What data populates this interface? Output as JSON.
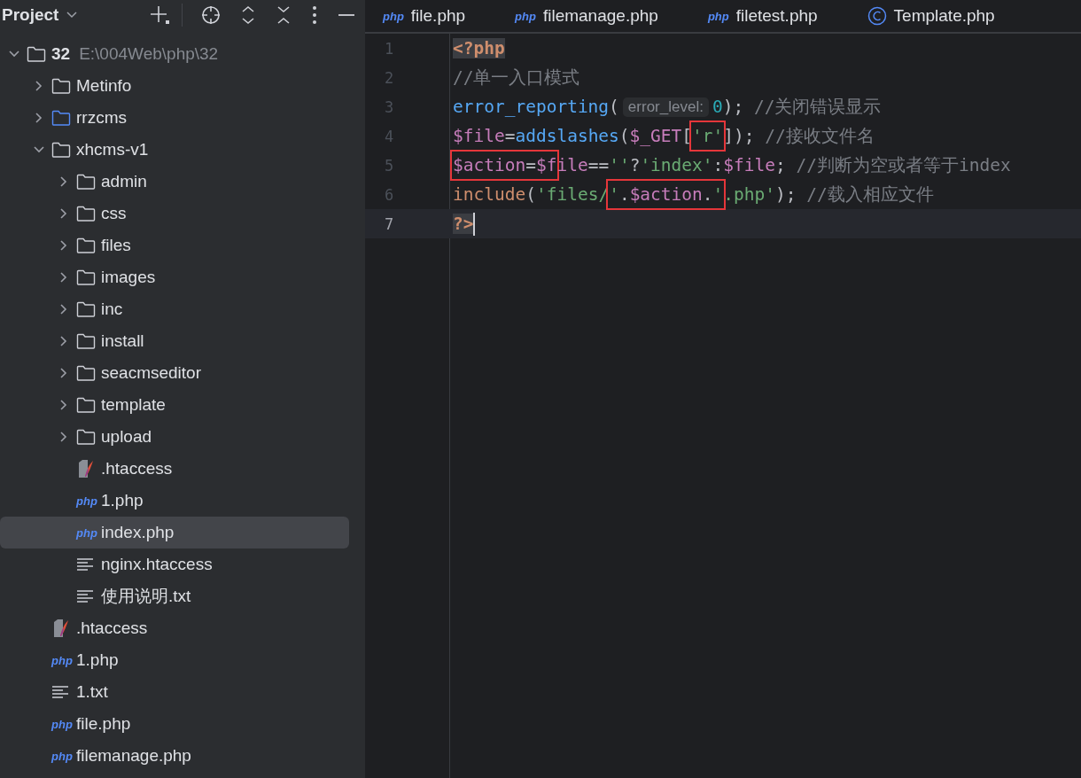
{
  "project_panel": {
    "title": "Project",
    "tree": [
      {
        "name": "32",
        "path": "E:\\004Web\\php\\32",
        "kind": "folder",
        "expanded": true,
        "selected": false,
        "children": [
          {
            "name": "Metinfo",
            "kind": "folder",
            "expanded": false,
            "selected": false
          },
          {
            "name": "rrzcms",
            "kind": "module",
            "expanded": false,
            "selected": false
          },
          {
            "name": "xhcms-v1",
            "kind": "folder",
            "expanded": true,
            "selected": false,
            "children": [
              {
                "name": "admin",
                "kind": "folder",
                "expanded": false,
                "selected": false
              },
              {
                "name": "css",
                "kind": "folder",
                "expanded": false,
                "selected": false
              },
              {
                "name": "files",
                "kind": "folder",
                "expanded": false,
                "selected": false
              },
              {
                "name": "images",
                "kind": "folder",
                "expanded": false,
                "selected": false
              },
              {
                "name": "inc",
                "kind": "folder",
                "expanded": false,
                "selected": false
              },
              {
                "name": "install",
                "kind": "folder",
                "expanded": false,
                "selected": false
              },
              {
                "name": "seacmseditor",
                "kind": "folder",
                "expanded": false,
                "selected": false
              },
              {
                "name": "template",
                "kind": "folder",
                "expanded": false,
                "selected": false
              },
              {
                "name": "upload",
                "kind": "folder",
                "expanded": false,
                "selected": false
              },
              {
                "name": ".htaccess",
                "kind": "htaccess",
                "selected": false
              },
              {
                "name": "1.php",
                "kind": "php",
                "badge": "php",
                "selected": false
              },
              {
                "name": "index.php",
                "kind": "php",
                "badge": "php",
                "selected": true
              },
              {
                "name": "nginx.htaccess",
                "kind": "text",
                "selected": false
              },
              {
                "name": "使用说明.txt",
                "kind": "text",
                "selected": false
              }
            ]
          },
          {
            "name": ".htaccess",
            "kind": "htaccess",
            "selected": false
          },
          {
            "name": "1.php",
            "kind": "php",
            "badge": "php",
            "selected": false
          },
          {
            "name": "1.txt",
            "kind": "text",
            "selected": false
          },
          {
            "name": "file.php",
            "kind": "php",
            "badge": "php",
            "selected": false
          },
          {
            "name": "filemanage.php",
            "kind": "php",
            "badge": "php",
            "selected": false
          }
        ]
      }
    ]
  },
  "tabs": [
    {
      "label": "file.php",
      "kind": "php",
      "badge": "php"
    },
    {
      "label": "filemanage.php",
      "kind": "php",
      "badge": "php"
    },
    {
      "label": "filetest.php",
      "kind": "php",
      "badge": "php"
    },
    {
      "label": "Template.php",
      "kind": "class"
    }
  ],
  "editor": {
    "lines": [
      {
        "number": "1",
        "current": false,
        "parts": [
          {
            "kind": "tag",
            "text": "<?php"
          }
        ]
      },
      {
        "number": "2",
        "current": false,
        "parts": [
          {
            "kind": "comment",
            "text": "//单一入口模式"
          }
        ]
      },
      {
        "number": "3",
        "current": false,
        "parts": [
          {
            "kind": "fn",
            "text": "error_reporting"
          },
          {
            "kind": "punc",
            "text": "("
          },
          {
            "kind": "hint",
            "text": "error_level:"
          },
          {
            "kind": "num",
            "text": "0"
          },
          {
            "kind": "punc",
            "text": "); "
          },
          {
            "kind": "comment",
            "text": "//关闭错误显示"
          }
        ]
      },
      {
        "number": "4",
        "current": false,
        "parts": [
          {
            "kind": "var",
            "text": "$file"
          },
          {
            "kind": "punc",
            "text": "="
          },
          {
            "kind": "fn",
            "text": "addslashes"
          },
          {
            "kind": "punc",
            "text": "("
          },
          {
            "kind": "var",
            "text": "$_GET"
          },
          {
            "kind": "punc",
            "text": "["
          },
          {
            "kind": "outline",
            "parts": [
              {
                "kind": "str",
                "text": "'r'"
              }
            ]
          },
          {
            "kind": "punc",
            "text": "]); "
          },
          {
            "kind": "comment",
            "text": "//接收文件名"
          }
        ]
      },
      {
        "number": "5",
        "current": false,
        "parts": [
          {
            "kind": "outline",
            "parts": [
              {
                "kind": "var",
                "text": "$action"
              },
              {
                "kind": "punc",
                "text": "="
              },
              {
                "kind": "var",
                "text": "$f"
              }
            ]
          },
          {
            "kind": "var",
            "text": "ile"
          },
          {
            "kind": "punc",
            "text": "=="
          },
          {
            "kind": "str",
            "text": "''"
          },
          {
            "kind": "punc",
            "text": "?"
          },
          {
            "kind": "str",
            "text": "'index'"
          },
          {
            "kind": "punc",
            "text": ":"
          },
          {
            "kind": "var",
            "text": "$file"
          },
          {
            "kind": "punc",
            "text": "; "
          },
          {
            "kind": "comment",
            "text": "//判断为空或者等于index"
          }
        ]
      },
      {
        "number": "6",
        "current": false,
        "parts": [
          {
            "kind": "kw",
            "text": "include"
          },
          {
            "kind": "punc",
            "text": "("
          },
          {
            "kind": "str",
            "text": "'files/"
          },
          {
            "kind": "outline",
            "parts": [
              {
                "kind": "str",
                "text": "'"
              },
              {
                "kind": "punc",
                "text": "."
              },
              {
                "kind": "var",
                "text": "$action"
              },
              {
                "kind": "punc",
                "text": "."
              },
              {
                "kind": "str",
                "text": "'"
              }
            ]
          },
          {
            "kind": "str",
            "text": ".php'"
          },
          {
            "kind": "punc",
            "text": "); "
          },
          {
            "kind": "comment",
            "text": "//载入相应文件"
          }
        ]
      },
      {
        "number": "7",
        "current": true,
        "parts": [
          {
            "kind": "tag",
            "text": "?>"
          }
        ]
      }
    ]
  }
}
